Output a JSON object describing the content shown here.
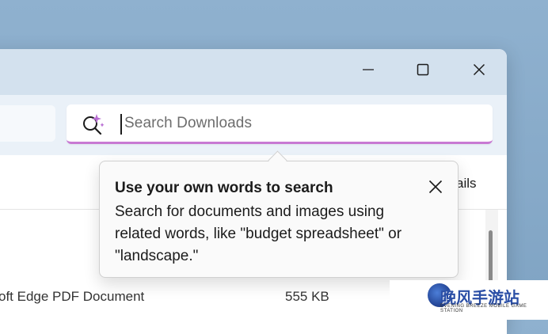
{
  "window": {
    "controls": {
      "minimize_icon": "minimize-icon",
      "maximize_icon": "maximize-icon",
      "close_icon": "close-icon"
    }
  },
  "search": {
    "placeholder": "Search Downloads",
    "accent_color": "#c879d3",
    "icon": "ai-search-icon"
  },
  "toolbar": {
    "details_partial": "ails"
  },
  "file_row": {
    "type": "oft Edge PDF Document",
    "size": "555 KB"
  },
  "tooltip": {
    "title": "Use your own words to search",
    "body": "Search for documents and images using related words, like \"budget spreadsheet\" or \"landscape.\"",
    "close_icon": "close-icon"
  },
  "watermark": {
    "text": "晚风手游站",
    "subtext": "EVENING BREEZE MOBILE GAME STATION"
  }
}
